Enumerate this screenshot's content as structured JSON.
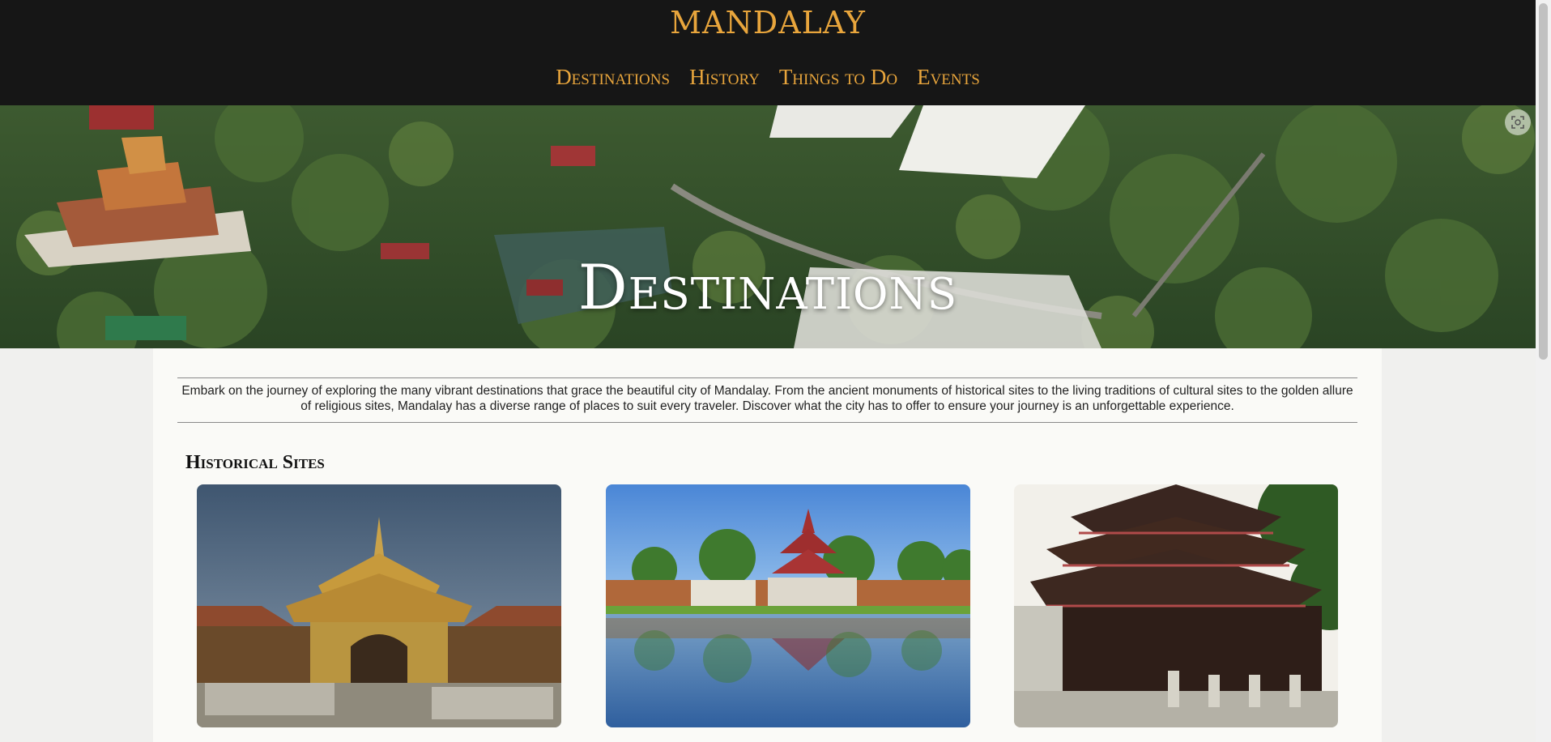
{
  "site": {
    "title": "MANDALAY"
  },
  "nav": {
    "items": [
      "Destinations",
      "History",
      "Things to Do",
      "Events"
    ]
  },
  "hero": {
    "title": "Destinations",
    "icon": "screen-capture-icon"
  },
  "intro": {
    "text": "Embark on the journey of exploring the many vibrant destinations that grace the beautiful city of Mandalay. From the ancient monuments of historical sites to the living traditions of cultural sites to the golden allure of religious sites, Mandalay has a diverse range of places to suit every traveler. Discover what the city has to offer to ensure your journey is an unforgettable experience."
  },
  "sections": [
    {
      "title": "Historical Sites"
    }
  ],
  "colors": {
    "accent": "#e8a53c",
    "header_bg": "#161616"
  }
}
